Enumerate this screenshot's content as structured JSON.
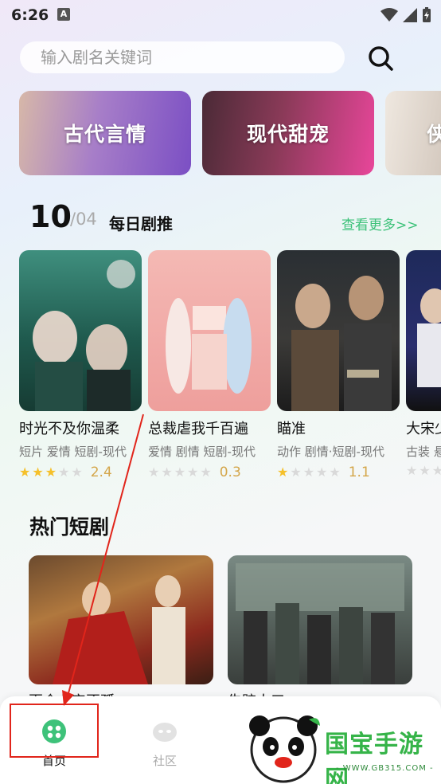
{
  "status_bar": {
    "time": "6:26",
    "a_badge": "A"
  },
  "search": {
    "placeholder": "输入剧名关键词"
  },
  "categories": [
    {
      "label": "古代言情"
    },
    {
      "label": "现代甜宠"
    },
    {
      "label": "侠"
    }
  ],
  "daily": {
    "day": "10",
    "month": "/04",
    "title": "每日剧推",
    "more": "查看更多>>"
  },
  "dramas": [
    {
      "title": "时光不及你温柔",
      "tags": "短片  爱情  短剧-现代",
      "stars": 3,
      "rating": "2.4"
    },
    {
      "title": "总裁虐我千百遍",
      "tags": "爱情  剧情  短剧-现代",
      "stars": 0,
      "rating": "0.3"
    },
    {
      "title": "瞄准",
      "tags": "动作  剧情·短剧-现代",
      "stars": 1,
      "rating": "1.1"
    },
    {
      "title": "大宋少",
      "tags": "古装  悬",
      "stars": 0,
      "rating": ""
    }
  ],
  "hot": {
    "title": "热门短剧",
    "items": [
      {
        "label": "百合心安不孤"
      },
      {
        "label": "失踪人口"
      }
    ]
  },
  "nav": {
    "items": [
      {
        "label": "首页",
        "active": true
      },
      {
        "label": "社区",
        "active": false
      }
    ]
  },
  "watermark": {
    "brand": "国宝手游网",
    "url": "- WWW.GB315.COM -"
  },
  "colors": {
    "accent": "#3ec27a",
    "star": "#f5c02a",
    "annotation": "#e1251b"
  }
}
